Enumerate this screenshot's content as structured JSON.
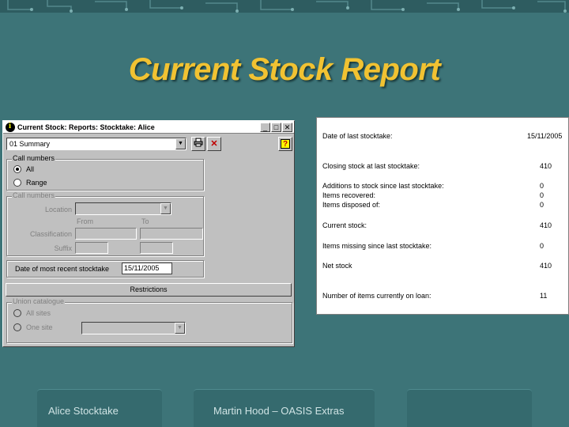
{
  "slide_title": "Current Stock Report",
  "window": {
    "title": "Current Stock: Reports: Stocktake: Alice",
    "buttons": {
      "minimize": "_",
      "maximize": "□",
      "close": "✕"
    },
    "report_select": "01 Summary",
    "call_numbers_group": {
      "legend": "Call numbers",
      "all_label": "All",
      "range_label": "Range",
      "selected": "All"
    },
    "call_numbers_range": {
      "legend": "Call numbers",
      "location_label": "Location",
      "from_label": "From",
      "to_label": "To",
      "classification_label": "Classification",
      "suffix_label": "Suffix"
    },
    "recent_stocktake_label": "Date of most recent stocktake",
    "recent_stocktake_value": "15/11/2005",
    "restrictions_label": "Restrictions",
    "union_catalogue": {
      "legend": "Union catalogue",
      "all_sites_label": "All sites",
      "one_site_label": "One site"
    }
  },
  "report": {
    "date_label": "Date of last stocktake:",
    "date_value": "15/11/2005",
    "rows": [
      {
        "label": "Closing stock at last stocktake:",
        "value": "410"
      },
      {
        "label": "Additions to stock since last stocktake:",
        "value": "0"
      },
      {
        "label": "Items recovered:",
        "value": "0"
      },
      {
        "label": "Items disposed of:",
        "value": "0"
      },
      {
        "label": "Current stock:",
        "value": "410"
      },
      {
        "label": "Items missing since last stocktake:",
        "value": "0"
      },
      {
        "label": "Net stock",
        "value": "410"
      },
      {
        "label": "Number of items currently on loan:",
        "value": "11"
      }
    ]
  },
  "footer": {
    "left": "Alice Stocktake",
    "center": "Martin Hood – OASIS Extras",
    "right": ""
  },
  "colors": {
    "background": "#3d7478",
    "title": "#f1c232"
  }
}
